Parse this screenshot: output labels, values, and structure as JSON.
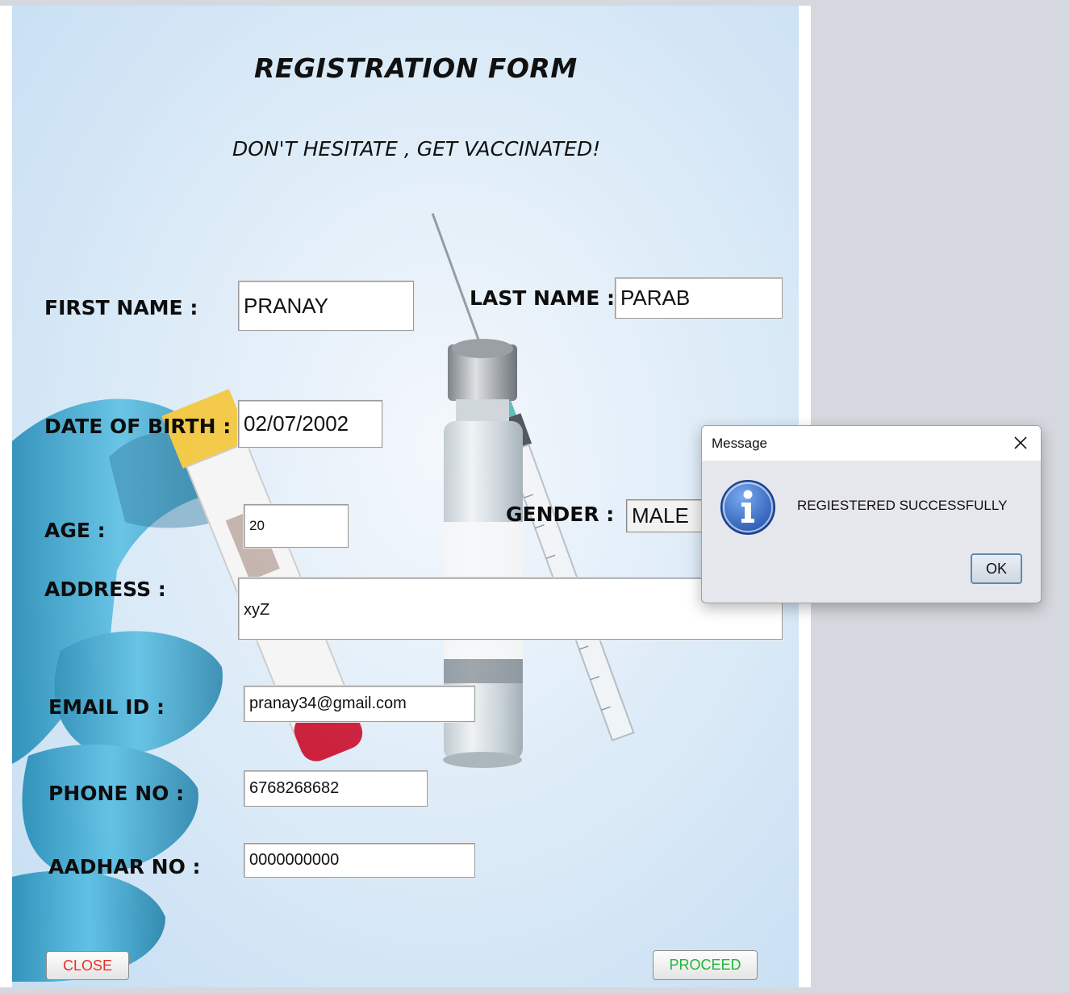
{
  "form": {
    "title": "REGISTRATION FORM",
    "subtitle": "DON'T HESITATE , GET VACCINATED!",
    "fields": {
      "first_name": {
        "label": "FIRST NAME :",
        "value": "PRANAY"
      },
      "last_name": {
        "label": "LAST NAME :",
        "value": "PARAB"
      },
      "dob": {
        "label": "DATE OF BIRTH :",
        "value": "02/07/2002"
      },
      "age": {
        "label": "AGE :",
        "value": "20"
      },
      "gender": {
        "label": "GENDER :",
        "value": "MALE"
      },
      "address": {
        "label": "ADDRESS :",
        "value": "xyZ"
      },
      "email": {
        "label": "EMAIL ID :",
        "value": "pranay34@gmail.com"
      },
      "phone": {
        "label": "PHONE NO :",
        "value": "6768268682"
      },
      "aadhar": {
        "label": "AADHAR NO :",
        "value": "0000000000"
      }
    },
    "buttons": {
      "close": "CLOSE",
      "proceed": "PROCEED"
    },
    "colors": {
      "close_text": "#e8302a",
      "proceed_text": "#22b43c"
    }
  },
  "dialog": {
    "title": "Message",
    "message": "REGIESTERED SUCCESSFULLY",
    "ok": "OK",
    "icon": "info-icon"
  }
}
